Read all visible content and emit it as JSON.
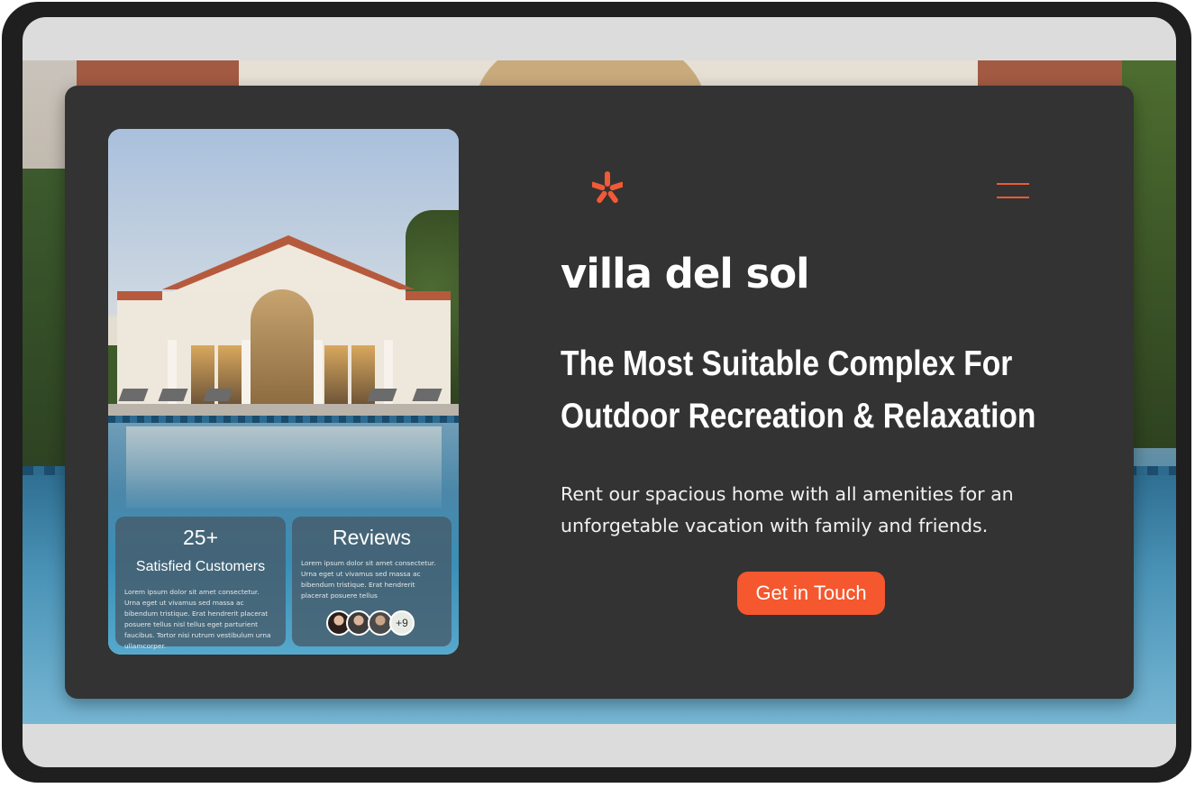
{
  "brand": {
    "name": "villa del sol",
    "accent_color": "#f5572e",
    "logo_icon": "yelp-burst-icon"
  },
  "nav": {
    "menu_icon": "hamburger-menu-icon"
  },
  "hero": {
    "headline_line1": "The Most Suitable Complex For",
    "headline_line2": "Outdoor Recreation & Relaxation",
    "description": "Rent our spacious home with all amenities for an unforgetable vacation with family and friends.",
    "cta_label": "Get in Touch"
  },
  "stats": {
    "customers": {
      "value": "25+",
      "label": "Satisfied Customers",
      "text": "Lorem ipsum dolor sit amet consectetur. Urna eget ut vivamus sed massa ac bibendum tristique. Erat hendrerit placerat posuere tellus nisl tellus eget parturient faucibus. Tortor nisi rutrum vestibulum urna ullamcorper."
    },
    "reviews": {
      "title": "Reviews",
      "text": "Lorem ipsum dolor sit amet consectetur. Urna eget ut vivamus sed massa ac bibendum tristique. Erat hendrerit placerat posuere tellus",
      "more_count": "+9"
    }
  }
}
